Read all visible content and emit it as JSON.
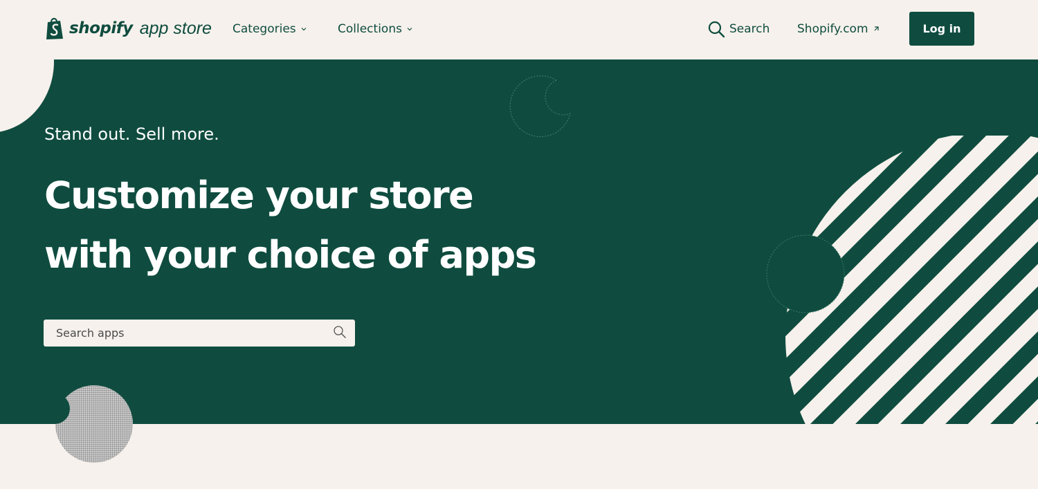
{
  "colors": {
    "brand_green": "#0f4c3f",
    "cream": "#f6f1ec",
    "white": "#ffffff"
  },
  "header": {
    "logo_brand": "shopify",
    "logo_sub": "app store",
    "nav": [
      {
        "label": "Categories",
        "icon": "chevron-down-icon"
      },
      {
        "label": "Collections",
        "icon": "chevron-down-icon"
      }
    ],
    "search_label": "Search",
    "search_icon": "search-icon",
    "shopify_link": "Shopify.com",
    "shopify_link_icon": "external-link-icon",
    "login_label": "Log in"
  },
  "hero": {
    "kicker": "Stand out. Sell more.",
    "title": "Customize your store with your choice of apps",
    "search": {
      "placeholder": "Search apps",
      "icon": "search-icon"
    }
  }
}
